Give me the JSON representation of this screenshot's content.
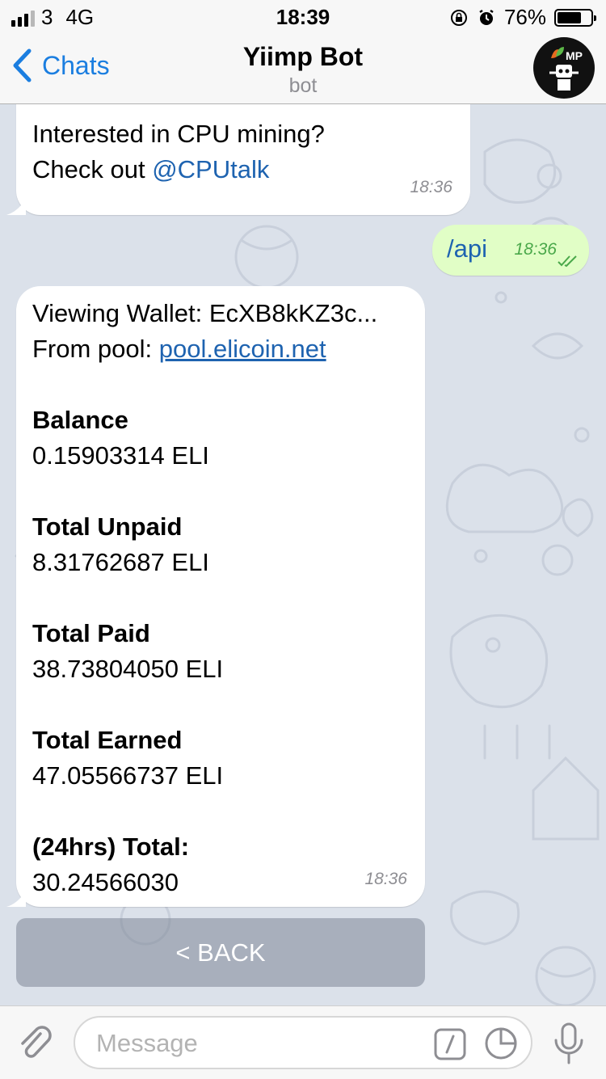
{
  "status_bar": {
    "carrier": "3",
    "network": "4G",
    "time": "18:39",
    "battery_percent": "76%",
    "battery_level": 0.76
  },
  "header": {
    "back_label": "Chats",
    "title": "Yiimp Bot",
    "subtitle": "bot",
    "avatar_text": "MP"
  },
  "messages": [
    {
      "line1": "Interested in CPU mining?",
      "line2_prefix": "Check out ",
      "line2_link": "@CPUtalk",
      "time": "18:36"
    },
    {
      "text": "/api",
      "time": "18:36"
    },
    {
      "wallet_line": "Viewing Wallet: EcXB8kKZ3c...",
      "pool_prefix": "From pool: ",
      "pool_link": "pool.elicoin.net",
      "balance_label": "Balance",
      "balance_value": "0.15903314 ELI",
      "unpaid_label": "Total Unpaid",
      "unpaid_value": "8.31762687 ELI",
      "paid_label": "Total Paid",
      "paid_value": "38.73804050 ELI",
      "earned_label": "Total Earned",
      "earned_value": "47.05566737 ELI",
      "total24_label": "(24hrs) Total:",
      "total24_value": "30.24566030",
      "time": "18:36"
    }
  ],
  "keyboard_button": "< BACK",
  "input": {
    "placeholder": "Message"
  },
  "colors": {
    "accent": "#1b7ee0",
    "outgoing_bubble": "#e1fec6",
    "chat_background": "#dbe1ea"
  }
}
